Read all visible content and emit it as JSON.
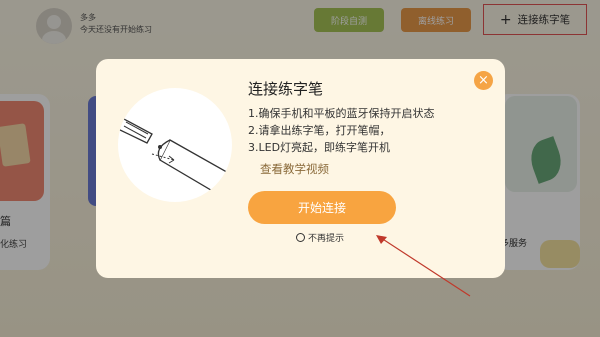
{
  "user": {
    "name": "多多",
    "status": "今天还没有开始练习"
  },
  "toolbar": {
    "stage_test_label": "阶段自测",
    "offline_practice_label": "离线练习",
    "connect_pen_label": "连接练字笔",
    "plus_icon": "+"
  },
  "background": {
    "left_card_title": "篇",
    "left_card_subtitle": "化练习",
    "right_card_title": "多服务"
  },
  "dialog": {
    "title": "连接练字笔",
    "steps": [
      "1.确保手机和平板的蓝牙保持开启状态",
      "2.请拿出练字笔，打开笔帽，",
      "3.LED灯亮起，即练字笔开机"
    ],
    "tutorial_link": "查看教学视频",
    "start_button": "开始连接",
    "no_remind": "不再提示",
    "close_icon": "×"
  },
  "colors": {
    "accent_orange": "#f8a440",
    "green_button": "#a6c356",
    "orange_button": "#e99a4a",
    "highlight_red": "#e25454"
  }
}
